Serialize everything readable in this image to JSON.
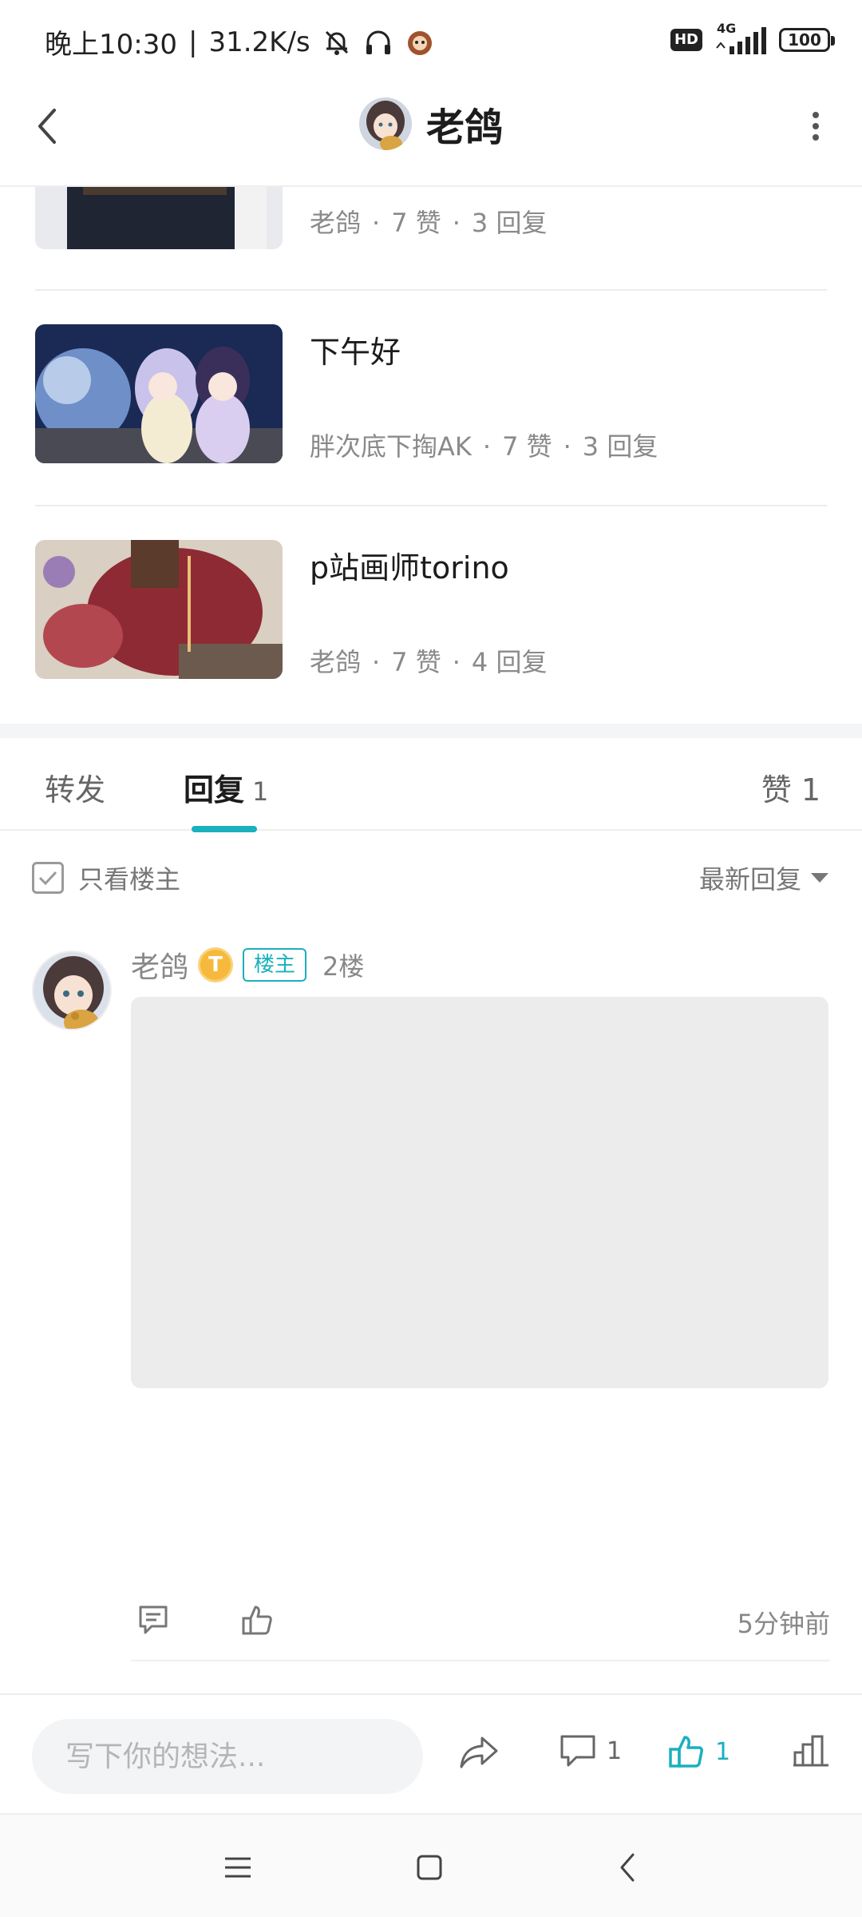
{
  "status_bar": {
    "time_label": "晚上10:30",
    "speed": "31.2K/s",
    "hd_label": "HD",
    "network_label": "4G",
    "battery": "100"
  },
  "header": {
    "title": "老鸽"
  },
  "related_posts": [
    {
      "title": "",
      "author": "老鸽",
      "likes": "7 赞",
      "replies": "3 回复"
    },
    {
      "title": "下午好",
      "author": "胖次底下掏AK",
      "likes": "7 赞",
      "replies": "3 回复"
    },
    {
      "title": "p站画师torino",
      "author": "老鸽",
      "likes": "7 赞",
      "replies": "4 回复"
    }
  ],
  "meta_separator": "·",
  "tabs": {
    "repost": {
      "label": "转发"
    },
    "reply": {
      "label": "回复",
      "count": "1"
    },
    "like": {
      "label": "赞 1"
    }
  },
  "filter": {
    "only_op_label": "只看楼主",
    "sort_label": "最新回复"
  },
  "reply": {
    "author": "老鸽",
    "level_badge": "T",
    "op_badge": "楼主",
    "floor": "2楼",
    "time": "5分钟前"
  },
  "composer": {
    "placeholder": "写下你的想法...",
    "comment_count": "1",
    "like_count": "1"
  },
  "colors": {
    "accent": "#1ab0bd",
    "level_badge": "#f6b93b",
    "placeholder_gray": "#ececec"
  }
}
